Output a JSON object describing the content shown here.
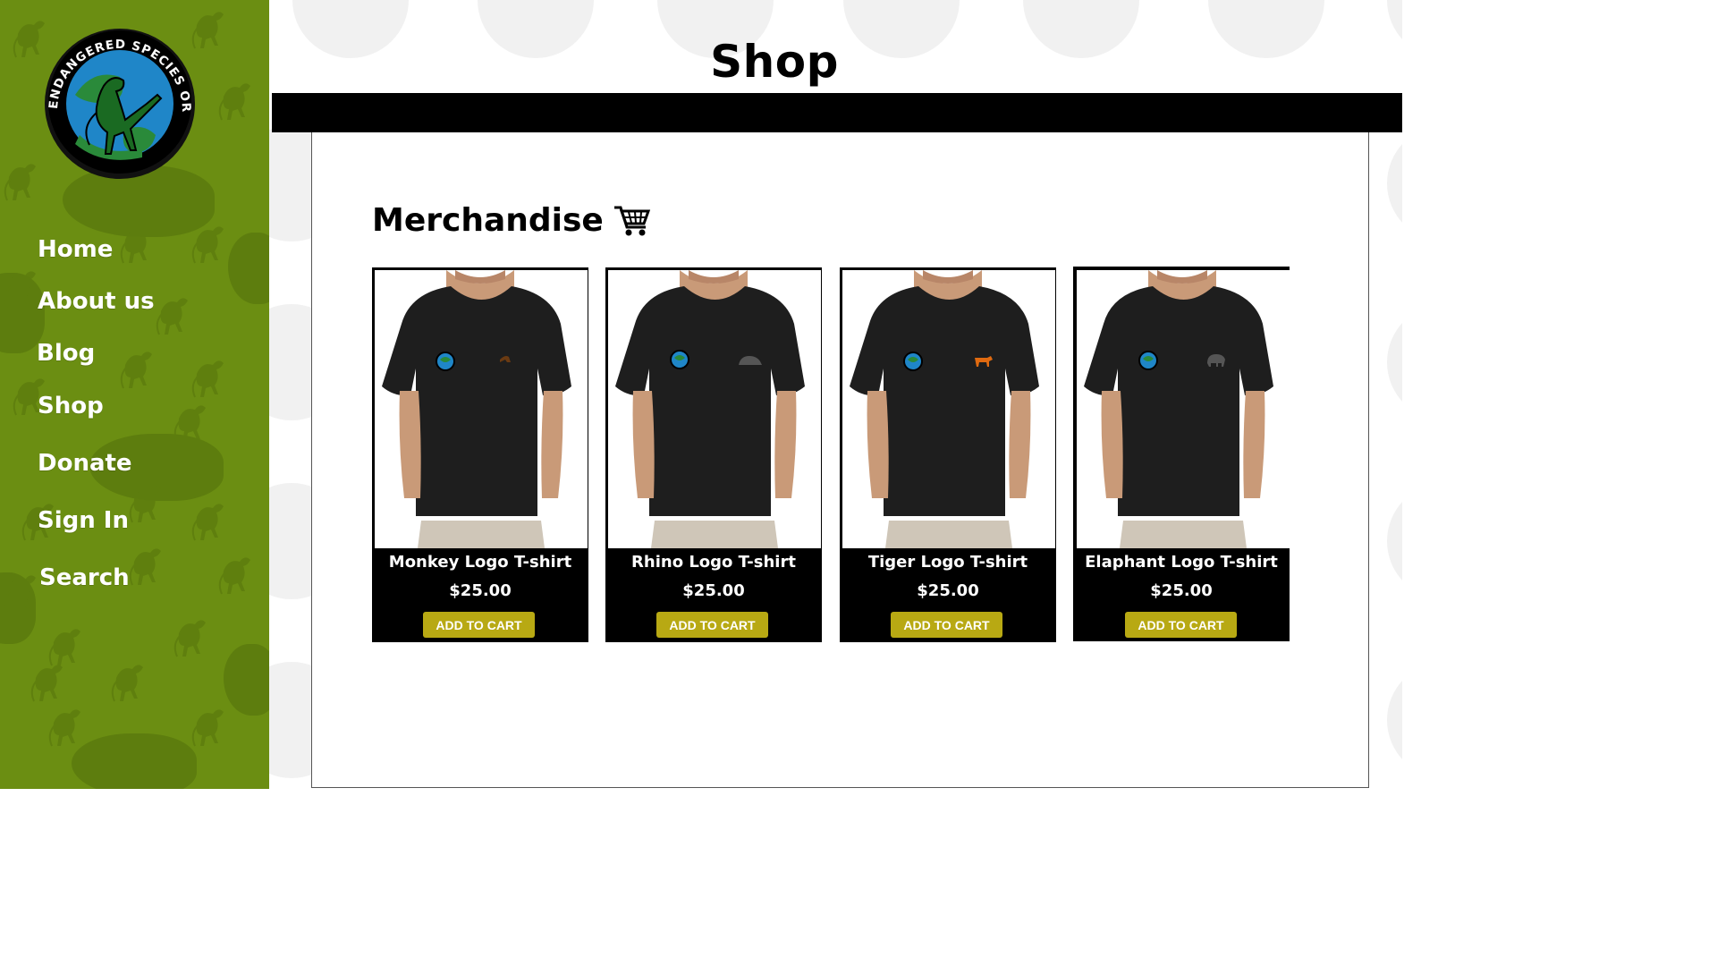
{
  "logo": {
    "text": "ENDANGERED SPECIES ORGANIZATION"
  },
  "nav": {
    "items": [
      {
        "label": "Home"
      },
      {
        "label": "About us"
      },
      {
        "label": "Blog"
      },
      {
        "label": "Shop"
      },
      {
        "label": "Donate"
      },
      {
        "label": "Sign In"
      },
      {
        "label": "Search"
      }
    ]
  },
  "page": {
    "title": "Shop"
  },
  "section": {
    "heading": "Merchandise",
    "icon": "cart-icon"
  },
  "products": [
    {
      "name": "Monkey Logo T-shirt",
      "price": "$25.00",
      "button": "ADD TO CART",
      "animal": "monkey",
      "animal_color": "#6a3a12"
    },
    {
      "name": "Rhino Logo T-shirt",
      "price": "$25.00",
      "button": "ADD TO CART",
      "animal": "rhino",
      "animal_color": "#555555"
    },
    {
      "name": "Tiger Logo T-shirt",
      "price": "$25.00",
      "button": "ADD TO CART",
      "animal": "tiger",
      "animal_color": "#e06a10"
    },
    {
      "name": "Elaphant Logo T-shirt",
      "price": "$25.00",
      "button": "ADD TO CART",
      "animal": "elephant",
      "animal_color": "#555555"
    }
  ],
  "colors": {
    "sidebar": "#6b8e12",
    "button": "#b8a913",
    "title_bar": "#000000"
  }
}
